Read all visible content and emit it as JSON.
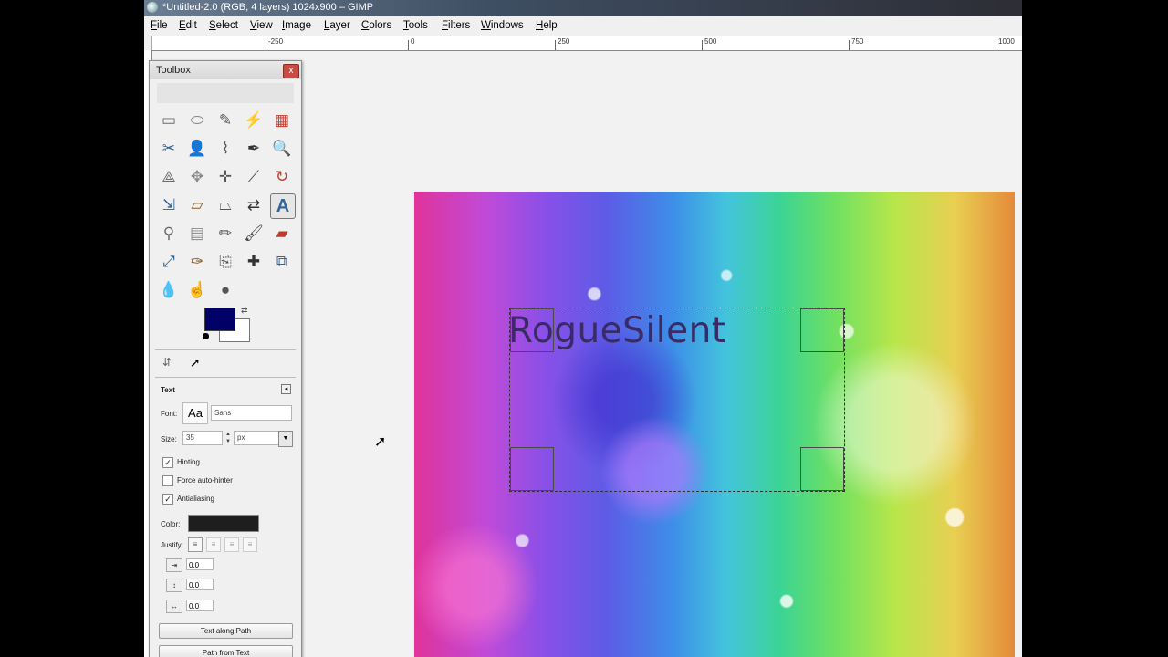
{
  "window": {
    "title": "*Untitled-2.0 (RGB, 4 layers) 1024x900 – GIMP"
  },
  "menubar": {
    "items": [
      "File",
      "Edit",
      "Select",
      "View",
      "Image",
      "Layer",
      "Colors",
      "Tools",
      "Filters",
      "Windows",
      "Help"
    ]
  },
  "ruler": {
    "labels": [
      "-250",
      "0",
      "250",
      "500",
      "750",
      "1000"
    ]
  },
  "canvas": {
    "layer_text": "RogueSilent"
  },
  "toolbox": {
    "title": "Toolbox",
    "close_glyph": "x",
    "tools": [
      {
        "name": "rect-select-tool",
        "glyph": "▭"
      },
      {
        "name": "ellipse-select-tool",
        "glyph": "⬭"
      },
      {
        "name": "free-select-tool",
        "glyph": "✎"
      },
      {
        "name": "fuzzy-select-tool",
        "glyph": "⚡"
      },
      {
        "name": "select-by-color-tool",
        "glyph": "▦"
      },
      {
        "name": "scissors-select-tool",
        "glyph": "✂"
      },
      {
        "name": "foreground-select-tool",
        "glyph": "👤"
      },
      {
        "name": "paths-tool",
        "glyph": "⌇"
      },
      {
        "name": "color-picker-tool",
        "glyph": "✒"
      },
      {
        "name": "zoom-tool",
        "glyph": "🔍"
      },
      {
        "name": "measure-tool",
        "glyph": "⟁"
      },
      {
        "name": "move-tool",
        "glyph": "✥"
      },
      {
        "name": "align-tool",
        "glyph": "✛"
      },
      {
        "name": "crop-tool",
        "glyph": "⟋"
      },
      {
        "name": "rotate-tool",
        "glyph": "↻"
      },
      {
        "name": "scale-tool",
        "glyph": "⇲"
      },
      {
        "name": "shear-tool",
        "glyph": "▱"
      },
      {
        "name": "perspective-tool",
        "glyph": "⏢"
      },
      {
        "name": "flip-tool",
        "glyph": "⇄"
      },
      {
        "name": "text-tool",
        "glyph": "A"
      },
      {
        "name": "cage-transform-tool",
        "glyph": "⚲"
      },
      {
        "name": "blend-tool",
        "glyph": "▤"
      },
      {
        "name": "pencil-tool",
        "glyph": "✏"
      },
      {
        "name": "paintbrush-tool",
        "glyph": "🖌"
      },
      {
        "name": "eraser-tool",
        "glyph": "▰"
      },
      {
        "name": "airbrush-tool",
        "glyph": "⤢"
      },
      {
        "name": "ink-tool",
        "glyph": "✑"
      },
      {
        "name": "clone-tool",
        "glyph": "⎘"
      },
      {
        "name": "heal-tool",
        "glyph": "✚"
      },
      {
        "name": "perspective-clone-tool",
        "glyph": "⧉"
      },
      {
        "name": "blur-sharpen-tool",
        "glyph": "💧"
      },
      {
        "name": "smudge-tool",
        "glyph": "☝"
      },
      {
        "name": "dodge-burn-tool",
        "glyph": "●"
      }
    ],
    "tab_icons": [
      "device-status",
      "pointer"
    ],
    "options": {
      "title": "Text",
      "font_label": "Font:",
      "font_preview": "Aa",
      "font_value": "Sans",
      "size_label": "Size:",
      "size_value": "35",
      "unit_value": "px",
      "hinting_label": "Hinting",
      "hinting_checked": true,
      "force_autohinter_label": "Force auto-hinter",
      "force_autohinter_checked": false,
      "antialiasing_label": "Antialiasing",
      "antialiasing_checked": true,
      "color_label": "Color:",
      "text_color": "#1e1e1e",
      "justify_label": "Justify:",
      "indent_value": "0.0",
      "line_spacing_value": "0.0",
      "letter_spacing_value": "0.0",
      "text_along_path_label": "Text along Path",
      "path_from_text_label": "Path from Text"
    },
    "fg_color": "#000066",
    "bg_color": "#ffffff"
  }
}
